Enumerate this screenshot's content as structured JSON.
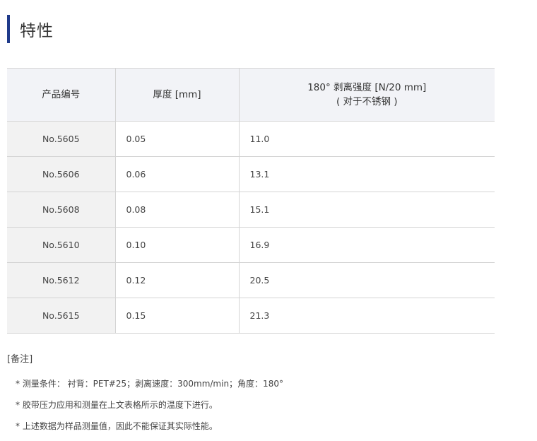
{
  "section": {
    "title": "特性"
  },
  "table": {
    "headers": [
      "产品编号",
      "厚度 [mm]",
      "180° 剥离强度 [N/20 mm]"
    ],
    "header_sub": "( 对于不锈钢 )",
    "rows": [
      [
        "No.5605",
        "0.05",
        "11.0"
      ],
      [
        "No.5606",
        "0.06",
        "13.1"
      ],
      [
        "No.5608",
        "0.08",
        "15.1"
      ],
      [
        "No.5610",
        "0.10",
        "16.9"
      ],
      [
        "No.5612",
        "0.12",
        "20.5"
      ],
      [
        "No.5615",
        "0.15",
        "21.3"
      ]
    ]
  },
  "notes": {
    "title": "[备注]",
    "items": [
      "* 测量条件： 衬背：PET#25；剥离速度：300mm/min；角度：180°",
      "* 胶带压力应用和测量在上文表格所示的温度下进行。",
      "* 上述数据为样品测量值，因此不能保证其实际性能。"
    ]
  },
  "colors": {
    "accent_bar": "#1f3a8a",
    "header_bg": "#f2f3f7",
    "product_cell_bg": "#f2f2f2",
    "border": "#d4d4d4"
  }
}
